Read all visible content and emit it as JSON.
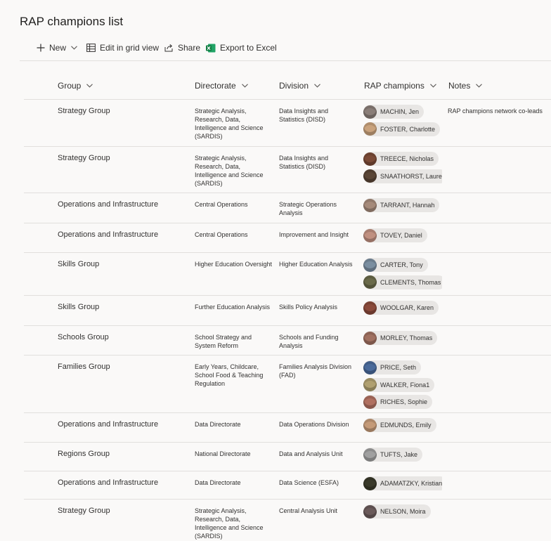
{
  "page": {
    "title": "RAP champions list"
  },
  "commands": {
    "new": "New",
    "edit_grid": "Edit in grid view",
    "share": "Share",
    "export": "Export to Excel"
  },
  "columns": {
    "group": "Group",
    "directorate": "Directorate",
    "division": "Division",
    "champions": "RAP champions",
    "notes": "Notes"
  },
  "rows": [
    {
      "group": "Strategy Group",
      "directorate": "Strategic Analysis, Research, Data, Intelligence and Science (SARDIS)",
      "division": "Data Insights and Statistics (DISD)",
      "champions": [
        "MACHIN, Jen",
        "FOSTER, Charlotte"
      ],
      "notes": "RAP champions network co-leads"
    },
    {
      "group": "Strategy Group",
      "directorate": "Strategic Analysis, Research, Data, Intelligence and Science (SARDIS)",
      "division": "Data Insights and Statistics (DISD)",
      "champions": [
        "TREECE, Nicholas",
        "SNAATHORST, Laure"
      ],
      "notes": ""
    },
    {
      "group": "Operations and Infrastructure",
      "directorate": "Central Operations",
      "division": "Strategic Operations Analysis",
      "champions": [
        "TARRANT, Hannah"
      ],
      "notes": ""
    },
    {
      "group": "Operations and Infrastructure",
      "directorate": "Central Operations",
      "division": "Improvement and Insight",
      "champions": [
        "TOVEY, Daniel"
      ],
      "notes": ""
    },
    {
      "group": "Skills Group",
      "directorate": "Higher Education Oversight",
      "division": "Higher Education Analysis",
      "champions": [
        "CARTER, Tony",
        "CLEMENTS, Thomas"
      ],
      "notes": ""
    },
    {
      "group": "Skills Group",
      "directorate": "Further Education Analysis",
      "division": "Skills Policy Analysis",
      "champions": [
        "WOOLGAR, Karen"
      ],
      "notes": ""
    },
    {
      "group": "Schools Group",
      "directorate": "School Strategy and System Reform",
      "division": "Schools and Funding Analysis",
      "champions": [
        "MORLEY, Thomas"
      ],
      "notes": ""
    },
    {
      "group": "Families Group",
      "directorate": "Early Years, Childcare, School Food & Teaching Regulation",
      "division": "Families Analysis Division (FAD)",
      "champions": [
        "PRICE, Seth",
        "WALKER, Fiona1",
        "RICHES, Sophie"
      ],
      "notes": ""
    },
    {
      "group": "Operations and Infrastructure",
      "directorate": "Data Directorate",
      "division": "Data Operations Division",
      "champions": [
        "EDMUNDS, Emily"
      ],
      "notes": ""
    },
    {
      "group": "Regions Group",
      "directorate": "National Directorate",
      "division": "Data and Analysis Unit",
      "champions": [
        "TUFTS, Jake"
      ],
      "notes": ""
    },
    {
      "group": "Operations and Infrastructure",
      "directorate": "Data Directorate",
      "division": "Data Science (ESFA)",
      "champions": [
        "ADAMATZKY, Kristian"
      ],
      "notes": ""
    },
    {
      "group": "Strategy Group",
      "directorate": "Strategic Analysis, Research, Data, Intelligence and Science (SARDIS)",
      "division": "Central Analysis Unit",
      "champions": [
        "NELSON, Moira"
      ],
      "notes": ""
    }
  ],
  "colors": {
    "background": "#faf9f8",
    "text": "#323130",
    "divider": "#e1dfdd",
    "persona_bg": "#e8e6e4",
    "accent": "#0078d4",
    "excel_green": "#107c41"
  },
  "avatar_colors": [
    "#8a7e78",
    "#c9a27c",
    "#7a4a36",
    "#5a4636",
    "#a58a7a",
    "#c09080",
    "#7a8ea0",
    "#6a6a4a",
    "#8a4a3a",
    "#a07060",
    "#4a6a9a",
    "#b0a070",
    "#b07060",
    "#c49a78",
    "#a0a0a0",
    "#3a3a2a",
    "#6a5a5a"
  ]
}
